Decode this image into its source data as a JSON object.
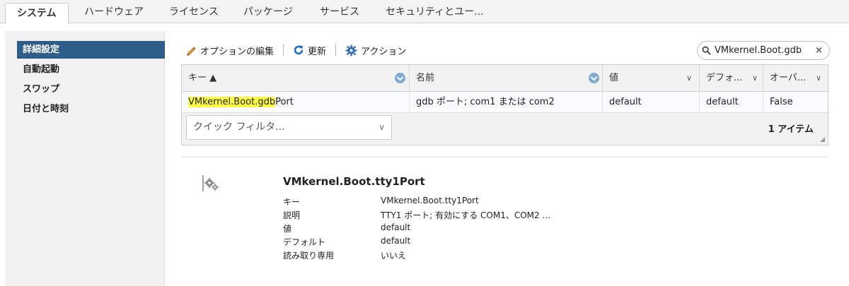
{
  "tabs": [
    {
      "label": "システム",
      "active": true
    },
    {
      "label": "ハードウェア",
      "active": false
    },
    {
      "label": "ライセンス",
      "active": false
    },
    {
      "label": "パッケージ",
      "active": false
    },
    {
      "label": "サービス",
      "active": false
    },
    {
      "label": "セキュリティとユー...",
      "active": false
    }
  ],
  "sidebar": {
    "items": [
      {
        "label": "詳細設定",
        "selected": true
      },
      {
        "label": "自動起動",
        "selected": false
      },
      {
        "label": "スワップ",
        "selected": false
      },
      {
        "label": "日付と時刻",
        "selected": false
      }
    ]
  },
  "toolbar": {
    "edit_label": "オプションの編集",
    "refresh_label": "更新",
    "actions_label": "アクション"
  },
  "search": {
    "value": "VMkernel.Boot.gdb"
  },
  "grid": {
    "columns": [
      "キー ▲",
      "名前",
      "値",
      "デフォ...",
      "オーバ..."
    ],
    "row": {
      "key_match": "VMkernel.Boot.gdb",
      "key_rest": "Port",
      "name": "gdb ポート; com1 または com2",
      "value": "default",
      "default": "default",
      "override": "False"
    },
    "quick_filter_placeholder": "クイック フィルタ...",
    "item_count": "1 アイテム"
  },
  "detail": {
    "title": "VMkernel.Boot.tty1Port",
    "rows": [
      {
        "k": "キー",
        "v": "VMkernel.Boot.tty1Port"
      },
      {
        "k": "説明",
        "v": "TTY1 ポート; 有効にする COM1、COM2 ..."
      },
      {
        "k": "値",
        "v": "default"
      },
      {
        "k": "デフォルト",
        "v": "default"
      },
      {
        "k": "読み取り専用",
        "v": "いいえ"
      }
    ]
  },
  "colors": {
    "selected_nav": "#2e5d8a",
    "search_highlight": "#ffff44",
    "icon_blue": "#2e6db4",
    "refresh_blue": "#1f6fc8"
  }
}
